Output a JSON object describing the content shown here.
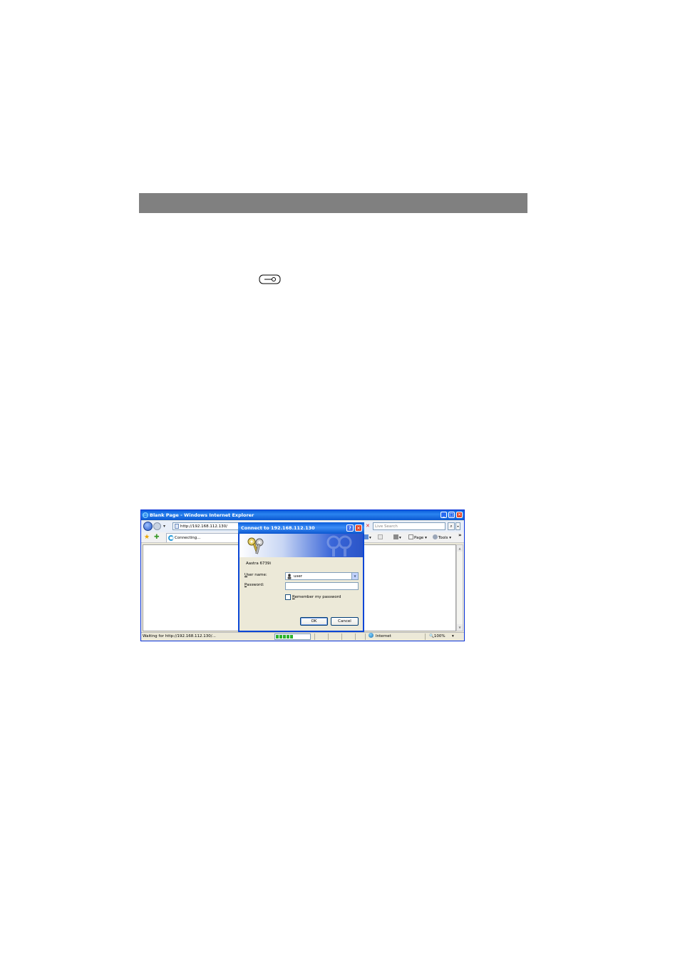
{
  "browser": {
    "title": "Blank Page - Windows Internet Explorer",
    "address": "http://192.168.112.130/",
    "search_placeholder": "Live Search",
    "tab_label": "Connecting...",
    "commands": {
      "page": "Page",
      "tools": "Tools"
    },
    "status_text": "Waiting for http://192.168.112.130/...",
    "zone": "Internet",
    "zoom": "100%",
    "progress_value": 0.5
  },
  "dialog": {
    "title": "Connect to 192.168.112.130",
    "realm": "Aastra 6739i",
    "username_label_key": "U",
    "username_label_rest": "ser name:",
    "password_label_key": "P",
    "password_label_rest": "assword:",
    "username_value": "user",
    "remember_key": "R",
    "remember_rest": "emember my password",
    "ok_label": "OK",
    "cancel_label": "Cancel"
  }
}
